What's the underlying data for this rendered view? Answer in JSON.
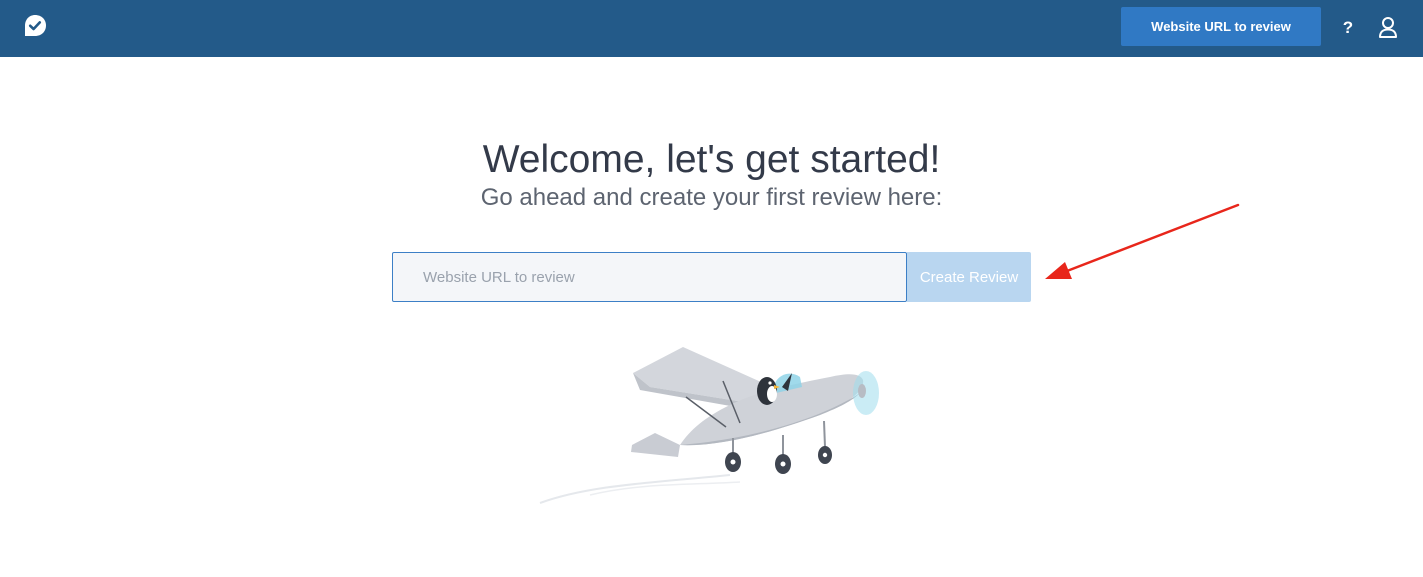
{
  "header": {
    "logo_icon": "checkmark-bubble-icon",
    "cta_label": "Website URL to review",
    "help_label": "?",
    "user_icon": "user-icon",
    "background_color": "#235a89",
    "button_color": "#3079c4"
  },
  "main": {
    "title": "Welcome, let's get started!",
    "subtitle": "Go ahead and create your first review here:",
    "url_input": {
      "placeholder": "Website URL to review",
      "value": ""
    },
    "create_button_label": "Create Review",
    "create_button_color": "#b9d6f0",
    "annotation_arrow_color": "#e8261b",
    "illustration_icon": "airplane-penguin-illustration"
  }
}
